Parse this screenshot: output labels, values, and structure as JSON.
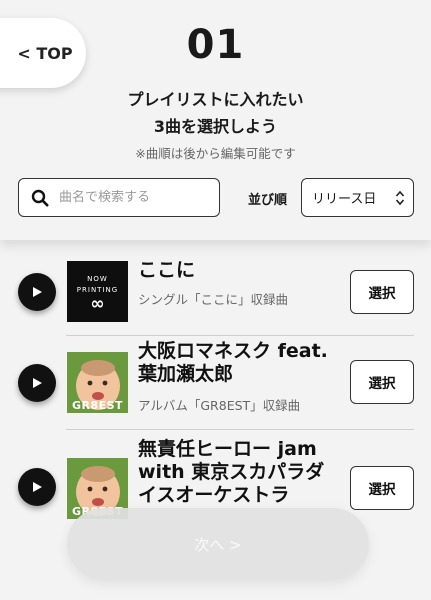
{
  "nav": {
    "top_label": "< TOP"
  },
  "step": {
    "number": "01",
    "heading_line1": "プレイリストに入れたい",
    "heading_line2": "3曲を選択しよう",
    "note": "※曲順は後から編集可能です"
  },
  "search": {
    "placeholder": "曲名で検索する",
    "value": ""
  },
  "sort": {
    "label": "並び順",
    "selected": "リリース日"
  },
  "songs": [
    {
      "title": "ここに",
      "subtitle": "シングル「ここに」収録曲",
      "select_label": "選択",
      "jacket_text_line1": "NOW",
      "jacket_text_line2": "PRINTING",
      "jacket_symbol": "∞"
    },
    {
      "title_line1": "大阪ロマネスク feat.",
      "title_line2": "葉加瀬太郎",
      "subtitle": "アルバム「GR8EST」収録曲",
      "select_label": "選択",
      "jacket_text": "GR8EST"
    },
    {
      "title_line1": "無責任ヒーロー jam",
      "title_line2": "with 東京スカパラダ",
      "title_line3": "イスオーケストラ",
      "select_label": "選択",
      "jacket_text": "GR8EST"
    }
  ],
  "footer": {
    "next_label": "次へ >"
  },
  "colors": {
    "background": "#f3f3f3",
    "accent": "#111111",
    "next_disabled": "#e1e1e1"
  }
}
